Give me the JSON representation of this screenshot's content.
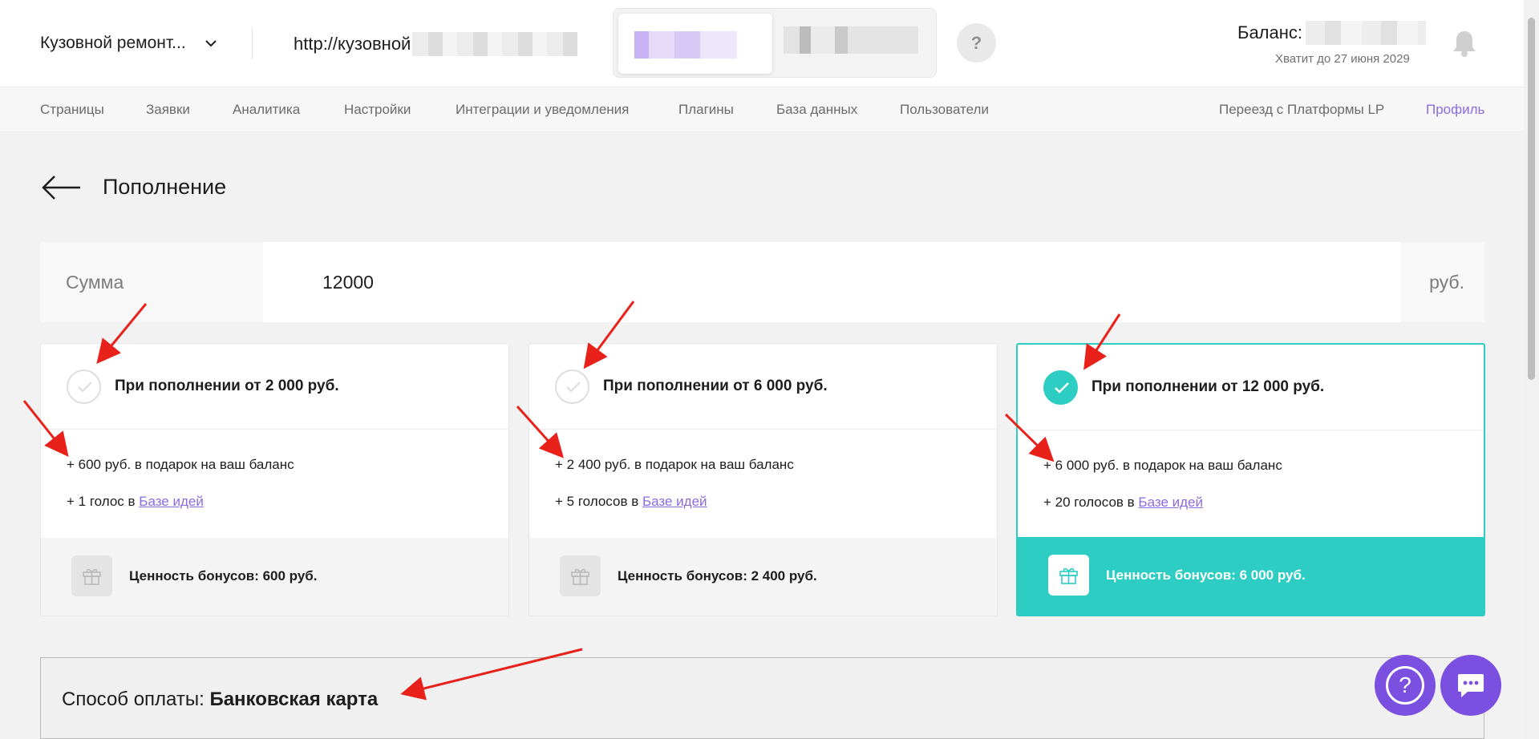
{
  "header": {
    "project_name": "Кузовной ремонт...",
    "url_prefix": "http://кузовной",
    "help_label": "?",
    "balance_label": "Баланс:",
    "balance_sub": "Хватит до 27 июня 2029"
  },
  "nav": {
    "items": [
      "Страницы",
      "Заявки",
      "Аналитика",
      "Настройки",
      "Интеграции и уведомления",
      "Плагины",
      "База данных",
      "Пользователи"
    ],
    "migration": "Переезд с Платформы LP",
    "profile": "Профиль"
  },
  "page": {
    "title": "Пополнение"
  },
  "amount": {
    "label": "Сумма",
    "value": "12000",
    "unit": "руб."
  },
  "cards": [
    {
      "title": "При пополнении от 2 000 руб.",
      "gift_text": "+ 600 руб. в подарок на ваш баланс",
      "votes_text": "+ 1 голос в ",
      "votes_link": "Базе идей",
      "bonus_value": "Ценность бонусов: 600 руб.",
      "selected": false
    },
    {
      "title": "При пополнении от 6 000 руб.",
      "gift_text": "+ 2 400 руб. в подарок на ваш баланс",
      "votes_text": "+ 5 голосов в ",
      "votes_link": "Базе идей",
      "bonus_value": "Ценность бонусов: 2 400 руб.",
      "selected": false
    },
    {
      "title": "При пополнении от 12 000 руб.",
      "gift_text": "+ 6 000 руб. в подарок на ваш баланс",
      "votes_text": "+ 20 голосов в ",
      "votes_link": "Базе идей",
      "bonus_value": "Ценность бонусов: 6 000 руб.",
      "selected": true
    }
  ],
  "payment": {
    "label": "Способ оплаты: ",
    "value": "Банковская карта"
  },
  "colors": {
    "accent_teal": "#2dcdc3",
    "accent_purple": "#7b4fe0",
    "link_purple": "#8a6be0",
    "annotation_red": "#e8221b"
  },
  "icons": {
    "project_dropdown": "chevron-down-icon",
    "bell": "bell-icon",
    "back": "arrow-left-icon",
    "check": "check-icon",
    "gift": "gift-icon",
    "help": "question-icon",
    "chat": "chat-icon"
  }
}
